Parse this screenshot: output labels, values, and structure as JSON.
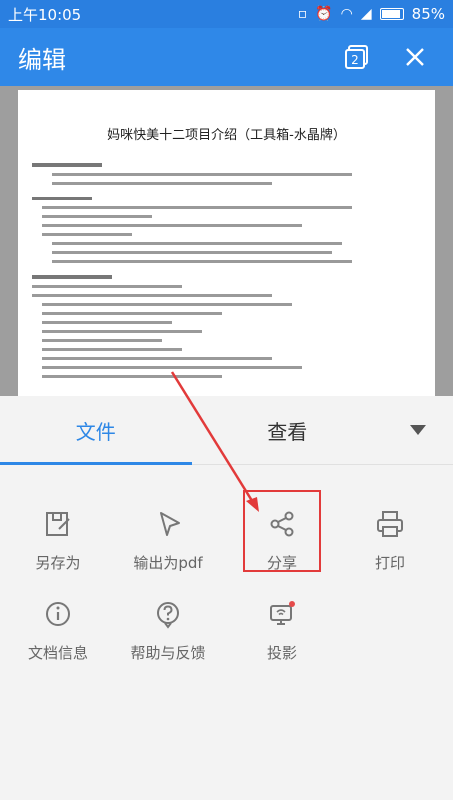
{
  "status_bar": {
    "time": "上午10:05",
    "battery": "85%"
  },
  "app_bar": {
    "title": "编辑",
    "icons": [
      "pages-icon",
      "close-icon"
    ]
  },
  "document": {
    "title": "妈咪快美十二项目介绍（工具箱-水晶牌）"
  },
  "tabs": [
    {
      "label": "文件",
      "active": true
    },
    {
      "label": "查看",
      "active": false
    }
  ],
  "menu": [
    {
      "label": "另存为",
      "icon": "save-as-icon"
    },
    {
      "label": "输出为pdf",
      "icon": "export-pdf-icon"
    },
    {
      "label": "分享",
      "icon": "share-icon"
    },
    {
      "label": "打印",
      "icon": "print-icon"
    },
    {
      "label": "文档信息",
      "icon": "info-icon"
    },
    {
      "label": "帮助与反馈",
      "icon": "help-icon"
    },
    {
      "label": "投影",
      "icon": "projection-icon"
    }
  ],
  "colors": {
    "accent": "#2d87e6",
    "appbar": "#2f88e8",
    "highlight": "#e23a3a"
  }
}
